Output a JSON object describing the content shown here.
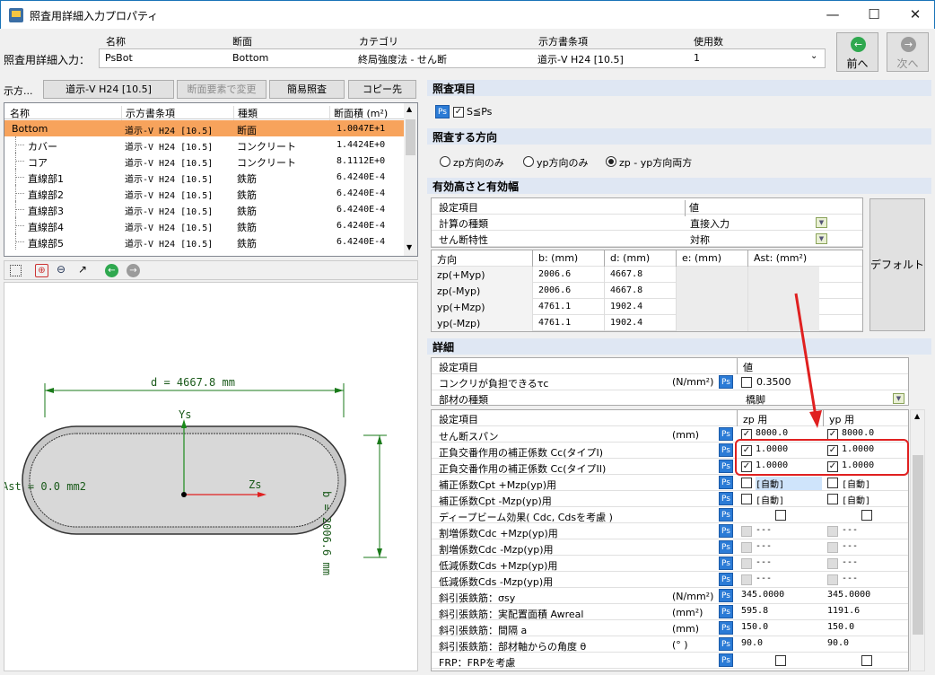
{
  "window": {
    "title": "照査用詳細入力プロパティ",
    "minimize": "—",
    "maximize": "☐",
    "close": "✕"
  },
  "header": {
    "row_label": "照査用詳細入力：",
    "col_name": "名称",
    "col_section": "断面",
    "col_category": "カテゴリ",
    "col_spec": "示方書条項",
    "col_count": "使用数",
    "val_name": "PsBot",
    "val_section": "Bottom",
    "val_category": "終局強度法 - せん断",
    "val_spec": "道示-V H24 [10.5]",
    "val_count": "1",
    "prev": "前へ",
    "next": "次へ"
  },
  "left_toolbar": {
    "label": "示方...",
    "spec": "道示-V H24 [10.5]",
    "change": "断面要素で変更",
    "simple": "簡易照査",
    "copy": "コピー先"
  },
  "tree": {
    "columns": [
      "名称",
      "示方書条項",
      "種類",
      "断面積 (m²)"
    ],
    "rows": [
      {
        "name": "Bottom",
        "spec": "道示-V H24 [10.5]",
        "kind": "断面",
        "area": "1.0047E+1"
      },
      {
        "name": "カバー",
        "spec": "道示-V H24 [10.5]",
        "kind": "コンクリート",
        "area": "1.4424E+0"
      },
      {
        "name": "コア",
        "spec": "道示-V H24 [10.5]",
        "kind": "コンクリート",
        "area": "8.1112E+0"
      },
      {
        "name": "直線部1",
        "spec": "道示-V H24 [10.5]",
        "kind": "鉄筋",
        "area": "6.4240E-4"
      },
      {
        "name": "直線部2",
        "spec": "道示-V H24 [10.5]",
        "kind": "鉄筋",
        "area": "6.4240E-4"
      },
      {
        "name": "直線部3",
        "spec": "道示-V H24 [10.5]",
        "kind": "鉄筋",
        "area": "6.4240E-4"
      },
      {
        "name": "直線部4",
        "spec": "道示-V H24 [10.5]",
        "kind": "鉄筋",
        "area": "6.4240E-4"
      },
      {
        "name": "直線部5",
        "spec": "道示-V H24 [10.5]",
        "kind": "鉄筋",
        "area": "6.4240E-4"
      }
    ]
  },
  "drawing": {
    "d_label": "d = 4667.8 mm",
    "b_label": "b = 2006.6 mm",
    "ys": "Ys",
    "zs": "Zs",
    "ast": "Ast = 0.0 mm2"
  },
  "check_items": {
    "title": "照査項目",
    "ps": "Ps",
    "item": "S≦Ps"
  },
  "direction": {
    "title": "照査する方向",
    "opt1": "zp方向のみ",
    "opt2": "yp方向のみ",
    "opt3": "zp - yp方向両方"
  },
  "effective": {
    "title": "有効高さと有効幅",
    "col_item": "設定項目",
    "col_value": "値",
    "row1_label": "計算の種類",
    "row1_value": "直接入力",
    "row2_label": "せん断特性",
    "row2_value": "対称",
    "dir_cols": [
      "方向",
      "b: (mm)",
      "d: (mm)",
      "e: (mm)",
      "Ast: (mm²)"
    ],
    "dir_rows": [
      {
        "dir": "zp(+Myp)",
        "b": "2006.6",
        "d": "4667.8"
      },
      {
        "dir": "zp(-Myp)",
        "b": "2006.6",
        "d": "4667.8"
      },
      {
        "dir": "yp(+Mzp)",
        "b": "4761.1",
        "d": "1902.4"
      },
      {
        "dir": "yp(-Mzp)",
        "b": "4761.1",
        "d": "1902.4"
      }
    ],
    "default": "デフォルト"
  },
  "detail": {
    "title": "詳細",
    "col_item": "設定項目",
    "col_value": "値",
    "tau_label": "コンクリが負担できるτc",
    "tau_unit": "(N/mm²)",
    "tau_value": "0.3500",
    "member_label": "部材の種類",
    "member_value": "橋脚",
    "col_zp": "zp 用",
    "col_yp": "yp 用",
    "rows": [
      {
        "label": "せん断スパン",
        "unit": "(mm)",
        "zp": "8000.0",
        "yp": "8000.0"
      },
      {
        "label": "正負交番作用の補正係数 Cc(タイプI)",
        "unit": "",
        "zp": "1.0000",
        "yp": "1.0000"
      },
      {
        "label": "正負交番作用の補正係数 Cc(タイプII)",
        "unit": "",
        "zp": "1.0000",
        "yp": "1.0000"
      },
      {
        "label": "補正係数Cpt  +Mzp(yp)用",
        "unit": "",
        "zp": "[自動]",
        "yp": "[自動]"
      },
      {
        "label": "補正係数Cpt  -Mzp(yp)用",
        "unit": "",
        "zp": "[自動]",
        "yp": "[自動]"
      },
      {
        "label": "ディープビーム効果( Cdc, Cdsを考慮 )",
        "unit": "",
        "zp": "",
        "yp": ""
      },
      {
        "label": "割増係数Cdc  +Mzp(yp)用",
        "unit": "",
        "zp": "---",
        "yp": "---"
      },
      {
        "label": "割増係数Cdc  -Mzp(yp)用",
        "unit": "",
        "zp": "---",
        "yp": "---"
      },
      {
        "label": "低減係数Cds  +Mzp(yp)用",
        "unit": "",
        "zp": "---",
        "yp": "---"
      },
      {
        "label": "低減係数Cds  -Mzp(yp)用",
        "unit": "",
        "zp": "---",
        "yp": "---"
      },
      {
        "label": "斜引張鉄筋：σsy",
        "unit": "(N/mm²)",
        "zp": "345.0000",
        "yp": "345.0000"
      },
      {
        "label": "斜引張鉄筋：実配置面積 Awreal",
        "unit": "(mm²)",
        "zp": "595.8",
        "yp": "1191.6"
      },
      {
        "label": "斜引張鉄筋：間隔 a",
        "unit": "(mm)",
        "zp": "150.0",
        "yp": "150.0"
      },
      {
        "label": "斜引張鉄筋：部材軸からの角度 θ",
        "unit": "(° )",
        "zp": "90.0",
        "yp": "90.0"
      },
      {
        "label": "FRP：FRPを考慮",
        "unit": "",
        "zp": "",
        "yp": ""
      }
    ]
  },
  "colors": {
    "accent": "#2b7bd6",
    "selected_row": "#f7a35c",
    "annotation": "#e02020",
    "section_header": "#dfe7f3"
  }
}
